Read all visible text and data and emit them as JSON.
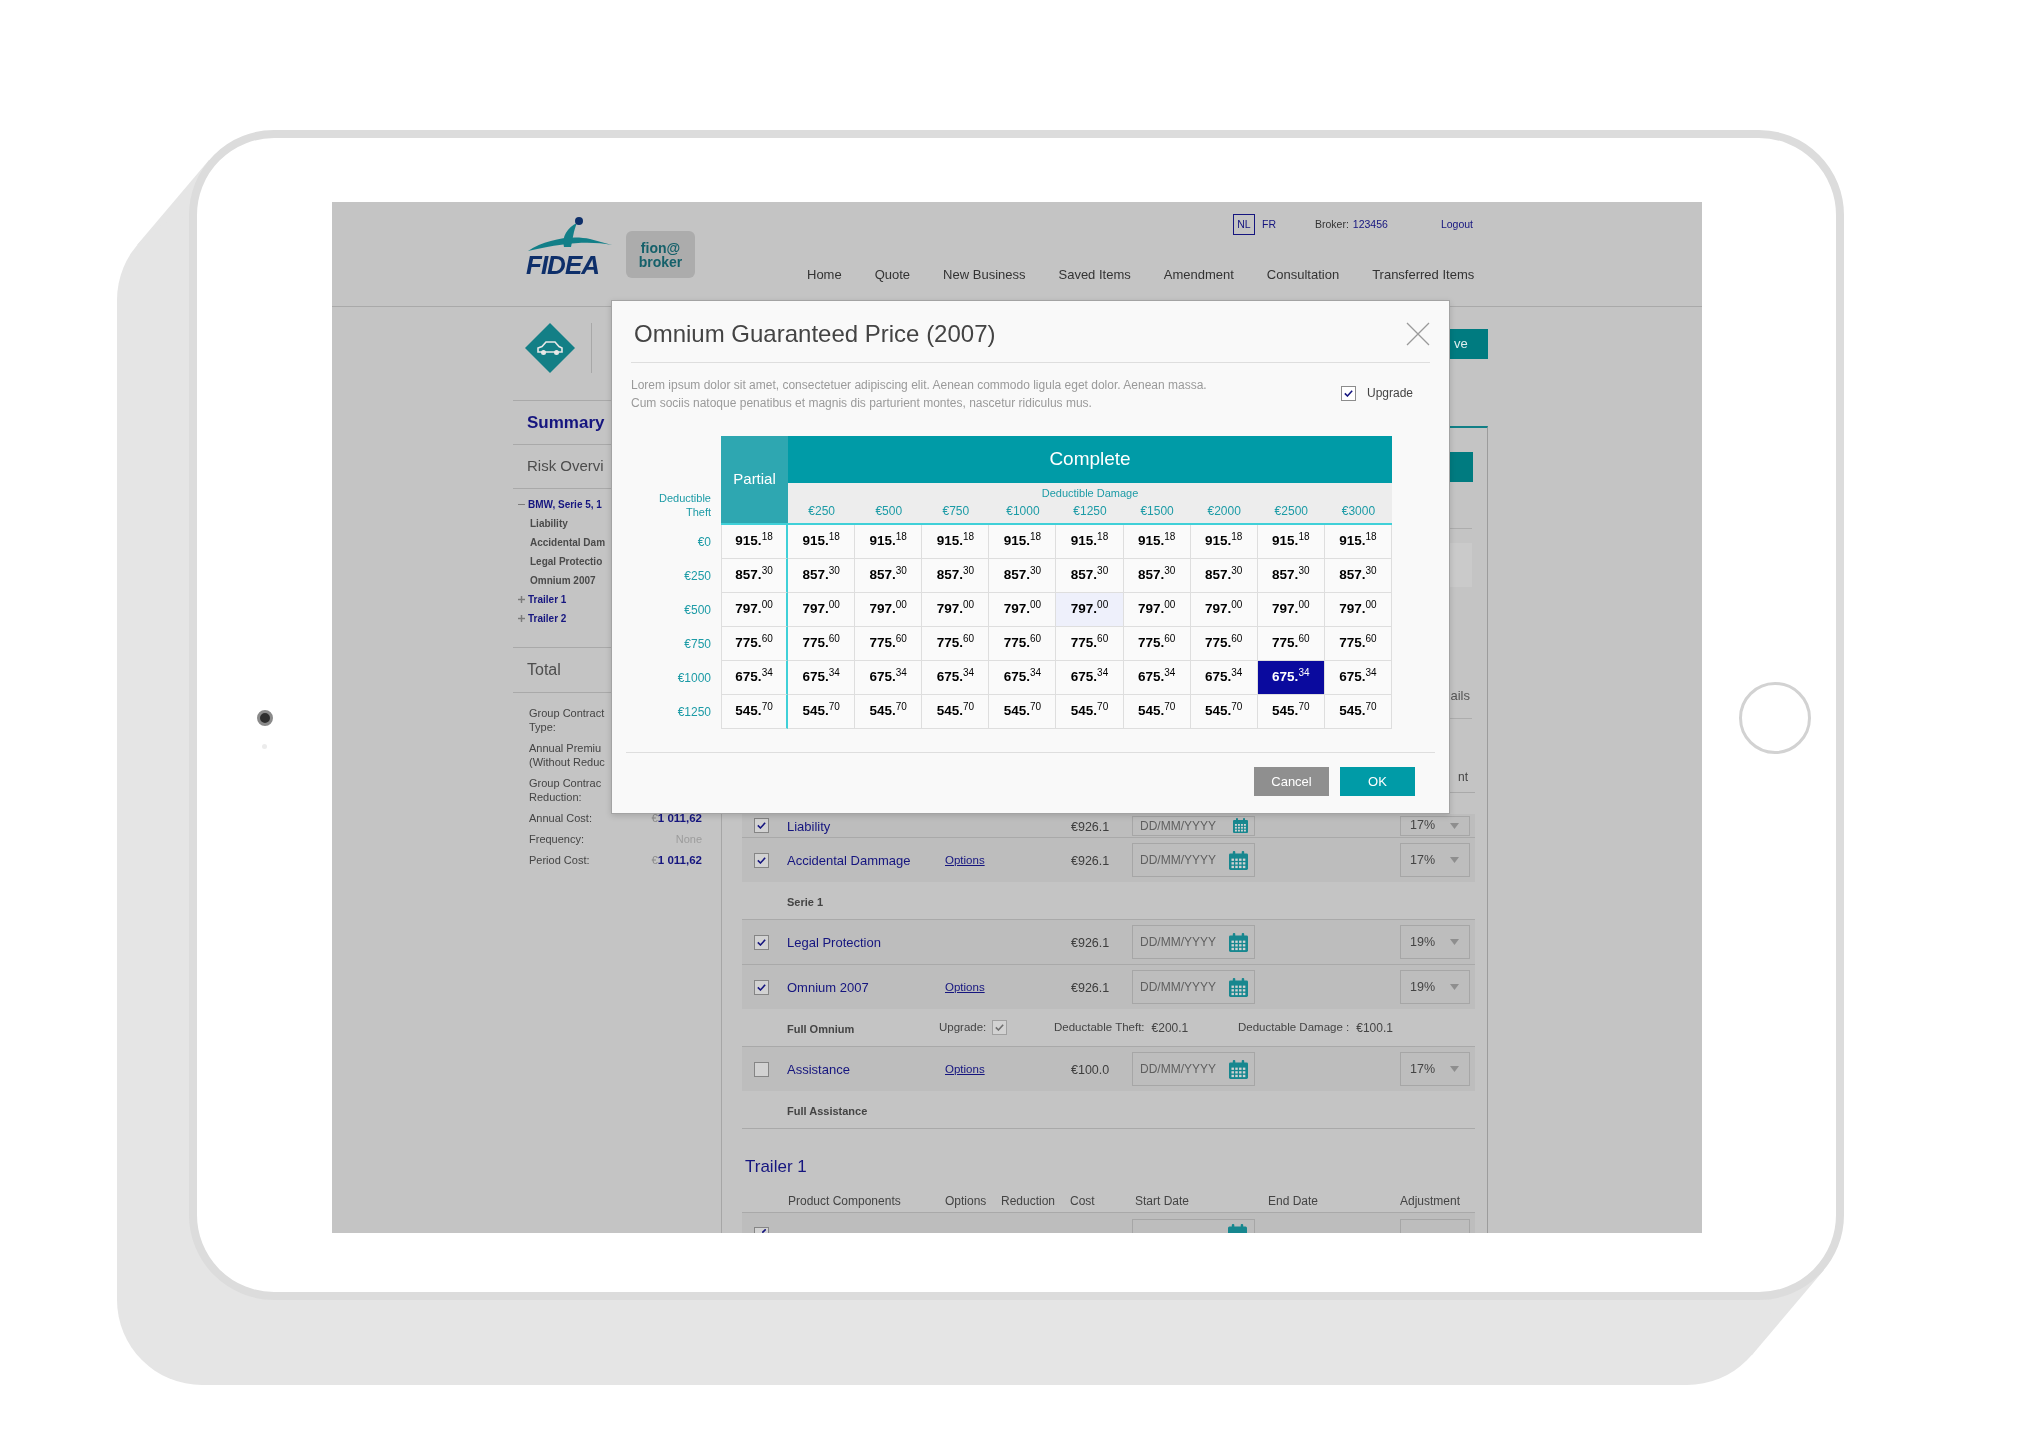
{
  "header": {
    "logo": "FIDEA",
    "badge": [
      "fion@",
      "broker"
    ],
    "languages": [
      {
        "label": "NL",
        "selected": true
      },
      {
        "label": "FR",
        "selected": false
      }
    ],
    "broker_label": "Broker:",
    "broker_id": "123456",
    "logout": "Logout",
    "nav": [
      "Home",
      "Quote",
      "New Business",
      "Saved Items",
      "Amendment",
      "Consultation",
      "Transferred Items"
    ]
  },
  "sidebar": {
    "summary": "Summary",
    "risk_overview": "Risk Overvi",
    "tree": [
      {
        "label": "BMW, Serie 5, 1",
        "expanded": true,
        "children": [
          {
            "label": "Liability"
          },
          {
            "label": "Accidental Dam"
          },
          {
            "label": "Legal Protectio"
          },
          {
            "label": "Omnium 2007"
          }
        ]
      },
      {
        "label": "Trailer 1",
        "expanded": false
      },
      {
        "label": "Trailer 2",
        "expanded": false
      }
    ],
    "total": "Total",
    "totals": [
      {
        "label": [
          "Group Contract",
          "Type:"
        ]
      },
      {
        "label": [
          "Annual Premiu",
          "(Without Reduc"
        ]
      },
      {
        "label": [
          "Group Contrac",
          "Reduction:"
        ]
      },
      {
        "label": [
          "Annual Cost:"
        ],
        "value": "€**1 011,62**",
        "kind": "amount"
      },
      {
        "label": [
          "Frequency:"
        ],
        "value": "None",
        "kind": "muted"
      },
      {
        "label": [
          "Period Cost:"
        ],
        "value": "€**1 011,62**",
        "kind": "amount"
      }
    ]
  },
  "panel": {
    "cut_button": "ve",
    "cut_text_1": "ails",
    "cut_text_2": "nt",
    "coverages": [
      {
        "name": "Liability",
        "checked": true,
        "cost": "€926.1",
        "start_date": {
          "placeholder": "DD/MM/YYYY"
        },
        "adjustment": "17%"
      },
      {
        "name": "Accidental Dammage",
        "checked": true,
        "options": "Options",
        "cost": "€926.1",
        "start_date": {
          "placeholder": "DD/MM/YYYY"
        },
        "adjustment": "17%",
        "detail": {
          "title": "Serie 1"
        }
      },
      {
        "name": "Legal Protection",
        "checked": true,
        "cost": "€926.1",
        "start_date": {
          "placeholder": "DD/MM/YYYY"
        },
        "adjustment": "19%"
      },
      {
        "name": "Omnium 2007",
        "checked": true,
        "options": "Options",
        "cost": "€926.1",
        "start_date": {
          "placeholder": "DD/MM/YYYY"
        },
        "adjustment": "19%",
        "detail": {
          "title": "Full Omnium",
          "upgrade": {
            "label": "Upgrade:",
            "checked": true,
            "disabled": true
          },
          "values": [
            {
              "label": "Deductable Theft:",
              "value": "€200.1"
            },
            {
              "label": "Deductable Damage :",
              "value": "€100.1"
            }
          ]
        }
      },
      {
        "name": "Assistance",
        "checked": false,
        "options": "Options",
        "cost": "€100.0",
        "start_date": {
          "placeholder": "DD/MM/YYYY"
        },
        "adjustment": "17%",
        "detail": {
          "title": "Full Assistance"
        }
      }
    ],
    "trailer": {
      "title": "Trailer 1",
      "columns": [
        "Product Components",
        "Options",
        "Reduction",
        "Cost",
        "Start Date",
        "End Date",
        "Adjustment"
      ],
      "rows": [
        {
          "checked": true
        }
      ]
    }
  },
  "modal": {
    "title": "Omnium Guaranteed Price (2007)",
    "description": [
      "Lorem ipsum dolor sit amet, consectetuer adipiscing elit. Aenean commodo ligula eget dolor. Aenean massa.",
      "Cum sociis natoque penatibus et magnis dis parturient montes, nascetur ridiculus mus."
    ],
    "upgrade": {
      "label": "Upgrade",
      "checked": true
    },
    "table": {
      "row_axis": "Deductible Theft",
      "partial_header": "Partial",
      "complete_header": "Complete",
      "column_axis": "Deductible Damage",
      "columns": [
        "",
        "€250",
        "€500",
        "€750",
        "€1000",
        "€1250",
        "€1500",
        "€2000",
        "€2500",
        "€3000"
      ],
      "rows": [
        {
          "label": "€0",
          "cells": [
            {
              "price": "915.$^{18}$",
              "selected": false,
              "hovered": false
            },
            {
              "price": "915.$^{18}$",
              "selected": false,
              "hovered": false
            },
            {
              "price": "915.$^{18}$",
              "selected": false,
              "hovered": false
            },
            {
              "price": "915.$^{18}$",
              "selected": false,
              "hovered": false
            },
            {
              "price": "915.$^{18}$",
              "selected": false,
              "hovered": false
            },
            {
              "price": "915.$^{18}$",
              "selected": false,
              "hovered": false
            },
            {
              "price": "915.$^{18}$",
              "selected": false,
              "hovered": false
            },
            {
              "price": "915.$^{18}$",
              "selected": false,
              "hovered": false
            },
            {
              "price": "915.$^{18}$",
              "selected": false,
              "hovered": false
            },
            {
              "price": "915.$^{18}$",
              "selected": false,
              "hovered": false
            }
          ]
        },
        {
          "label": "€250",
          "cells": [
            {
              "price": "857.$^{30}$",
              "selected": false,
              "hovered": false
            },
            {
              "price": "857.$^{30}$",
              "selected": false,
              "hovered": false
            },
            {
              "price": "857.$^{30}$",
              "selected": false,
              "hovered": false
            },
            {
              "price": "857.$^{30}$",
              "selected": false,
              "hovered": false
            },
            {
              "price": "857.$^{30}$",
              "selected": false,
              "hovered": false
            },
            {
              "price": "857.$^{30}$",
              "selected": false,
              "hovered": false
            },
            {
              "price": "857.$^{30}$",
              "selected": false,
              "hovered": false
            },
            {
              "price": "857.$^{30}$",
              "selected": false,
              "hovered": false
            },
            {
              "price": "857.$^{30}$",
              "selected": false,
              "hovered": false
            },
            {
              "price": "857.$^{30}$",
              "selected": false,
              "hovered": false
            }
          ]
        },
        {
          "label": "€500",
          "cells": [
            {
              "price": "797.$^{00}$",
              "selected": false,
              "hovered": false
            },
            {
              "price": "797.$^{00}$",
              "selected": false,
              "hovered": false
            },
            {
              "price": "797.$^{00}$",
              "selected": false,
              "hovered": false
            },
            {
              "price": "797.$^{00}$",
              "selected": false,
              "hovered": false
            },
            {
              "price": "797.$^{00}$",
              "selected": false,
              "hovered": false
            },
            {
              "price": "797.$^{00}$",
              "selected": false,
              "hovered": true
            },
            {
              "price": "797.$^{00}$",
              "selected": false,
              "hovered": false
            },
            {
              "price": "797.$^{00}$",
              "selected": false,
              "hovered": false
            },
            {
              "price": "797.$^{00}$",
              "selected": false,
              "hovered": false
            },
            {
              "price": "797.$^{00}$",
              "selected": false,
              "hovered": false
            }
          ]
        },
        {
          "label": "€750",
          "cells": [
            {
              "price": "775.$^{60}$",
              "selected": false,
              "hovered": false
            },
            {
              "price": "775.$^{60}$",
              "selected": false,
              "hovered": false
            },
            {
              "price": "775.$^{60}$",
              "selected": false,
              "hovered": false
            },
            {
              "price": "775.$^{60}$",
              "selected": false,
              "hovered": false
            },
            {
              "price": "775.$^{60}$",
              "selected": false,
              "hovered": false
            },
            {
              "price": "775.$^{60}$",
              "selected": false,
              "hovered": false
            },
            {
              "price": "775.$^{60}$",
              "selected": false,
              "hovered": false
            },
            {
              "price": "775.$^{60}$",
              "selected": false,
              "hovered": false
            },
            {
              "price": "775.$^{60}$",
              "selected": false,
              "hovered": false
            },
            {
              "price": "775.$^{60}$",
              "selected": false,
              "hovered": false
            }
          ]
        },
        {
          "label": "€1000",
          "cells": [
            {
              "price": "675.$^{34}$",
              "selected": false,
              "hovered": false
            },
            {
              "price": "675.$^{34}$",
              "selected": false,
              "hovered": false
            },
            {
              "price": "675.$^{34}$",
              "selected": false,
              "hovered": false
            },
            {
              "price": "675.$^{34}$",
              "selected": false,
              "hovered": false
            },
            {
              "price": "675.$^{34}$",
              "selected": false,
              "hovered": false
            },
            {
              "price": "675.$^{34}$",
              "selected": false,
              "hovered": false
            },
            {
              "price": "675.$^{34}$",
              "selected": false,
              "hovered": false
            },
            {
              "price": "675.$^{34}$",
              "selected": false,
              "hovered": false
            },
            {
              "price": "675.$^{34}$",
              "selected": true,
              "hovered": false
            },
            {
              "price": "675.$^{34}$",
              "selected": false,
              "hovered": false
            }
          ]
        },
        {
          "label": "€1250",
          "cells": [
            {
              "price": "545.$^{70}$",
              "selected": false,
              "hovered": false
            },
            {
              "price": "545.$^{70}$",
              "selected": false,
              "hovered": false
            },
            {
              "price": "545.$^{70}$",
              "selected": false,
              "hovered": false
            },
            {
              "price": "545.$^{70}$",
              "selected": false,
              "hovered": false
            },
            {
              "price": "545.$^{70}$",
              "selected": false,
              "hovered": false
            },
            {
              "price": "545.$^{70}$",
              "selected": false,
              "hovered": false
            },
            {
              "price": "545.$^{70}$",
              "selected": false,
              "hovered": false
            },
            {
              "price": "545.$^{70}$",
              "selected": false,
              "hovered": false
            },
            {
              "price": "545.$^{70}$",
              "selected": false,
              "hovered": false
            },
            {
              "price": "545.$^{70}$",
              "selected": false,
              "hovered": false
            }
          ]
        }
      ]
    },
    "buttons": [
      {
        "label": "Cancel",
        "kind": "secondary"
      },
      {
        "label": "OK",
        "kind": "primary"
      }
    ]
  }
}
